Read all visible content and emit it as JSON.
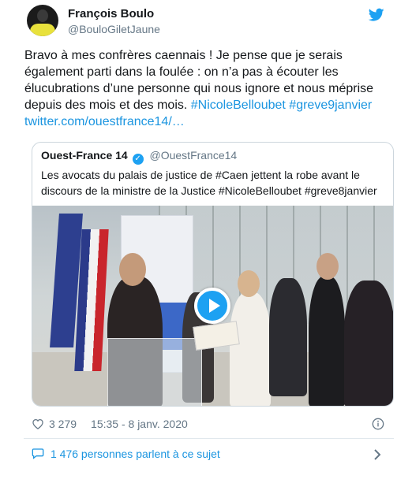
{
  "author": {
    "name": "François Boulo",
    "handle": "@BouloGiletJaune"
  },
  "tweet": {
    "text_plain": "Bravo à mes confrères caennais ! Je pense que je serais également parti dans la foulée : on n’a pas à écouter les élucubrations d’une personne qui nous ignore et nous méprise depuis des mois et des mois. ",
    "hashtag1": "#NicoleBelloubet",
    "hashtag2": "#greve9janvier",
    "link": "twitter.com/ouestfrance14/…"
  },
  "quoted": {
    "name": "Ouest-France 14",
    "handle": "@OuestFrance14",
    "text": "Les avocats du palais de justice de #Caen jettent la robe avant le discours de la ministre de la Justice #NicoleBelloubet #greve8janvier"
  },
  "meta": {
    "likes": "3 279",
    "timestamp": "15:35 - 8 janv. 2020"
  },
  "conversation": {
    "label": "1 476 personnes parlent à ce sujet"
  },
  "icons": {
    "brand": "twitter-bird-icon",
    "verified": "verified-badge-icon",
    "play": "play-icon",
    "like": "heart-icon",
    "info": "info-icon",
    "conversation": "speech-bubble-icon",
    "chevron": "chevron-right-icon"
  },
  "colors": {
    "link": "#1b95e0",
    "brand": "#1da1f2",
    "secondary_text": "#657786",
    "border": "#ccd6dd"
  }
}
